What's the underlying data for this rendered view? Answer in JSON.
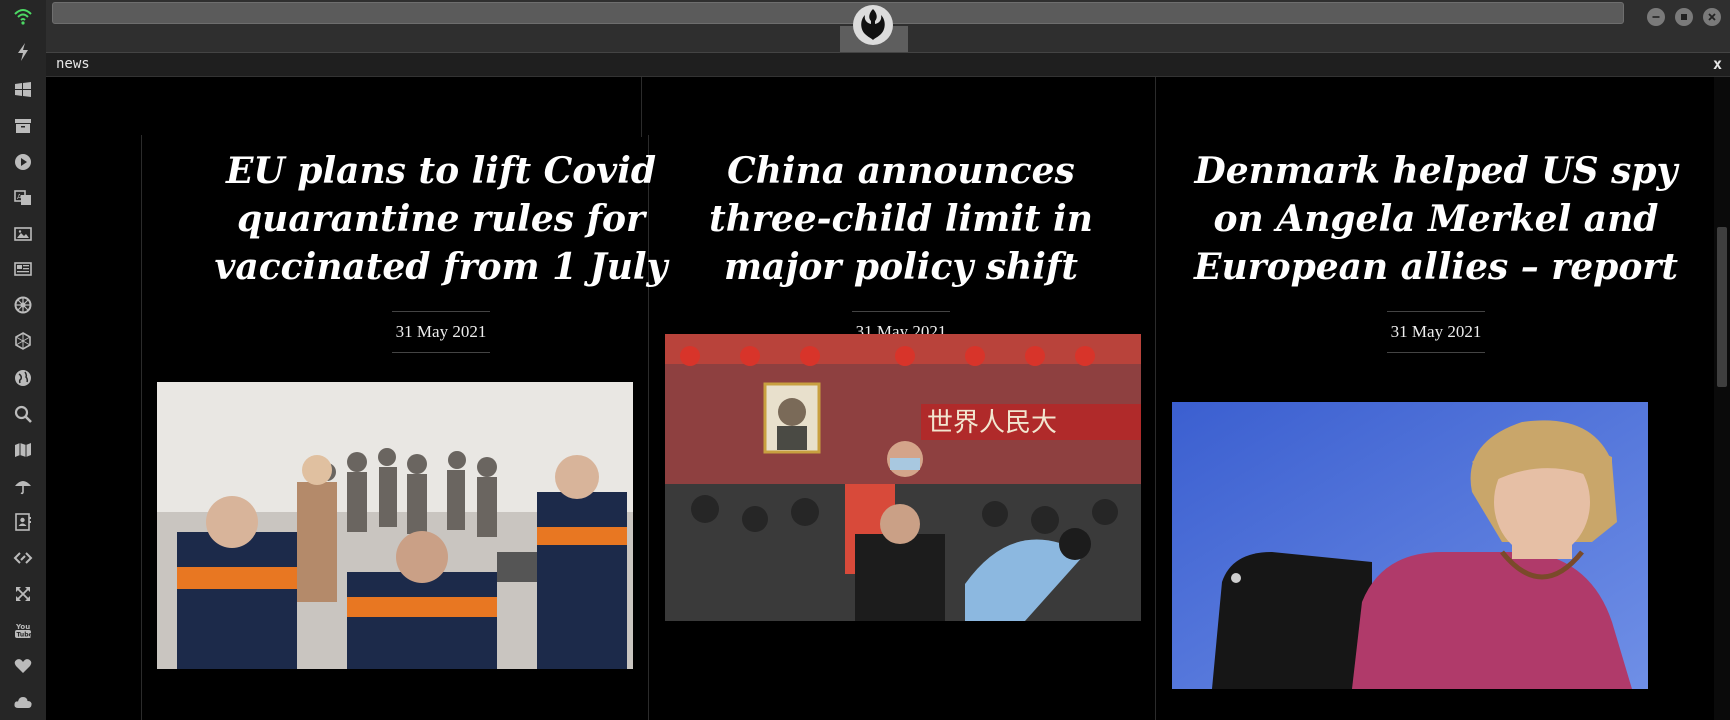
{
  "sidebar": {
    "icons": [
      "wifi-icon",
      "bolt-icon",
      "windows-icon",
      "archive-icon",
      "play-icon",
      "translate-icon",
      "image-icon",
      "newspaper-icon",
      "settings-wheel-icon",
      "hexagon-icon",
      "globe-icon",
      "search-icon",
      "map-icon",
      "umbrella-icon",
      "contacts-icon",
      "code-icon",
      "expand-icon",
      "youtube-icon",
      "heart-icon",
      "cloud-icon"
    ]
  },
  "panel": {
    "title": "news",
    "close": "x"
  },
  "articles": [
    {
      "headline": "EU plans to lift Covid quarantine rules for vaccinated from 1 July",
      "date": "31 May 2021"
    },
    {
      "headline": "China announces three-child limit in major policy shift",
      "date": "31 May 2021"
    },
    {
      "headline": "Denmark helped US spy on Angela Merkel and European allies – report",
      "date": "31 May 2021"
    }
  ],
  "colors": {
    "wifi": "#4cd964",
    "background": "#000000",
    "sidebar": "#262626"
  }
}
